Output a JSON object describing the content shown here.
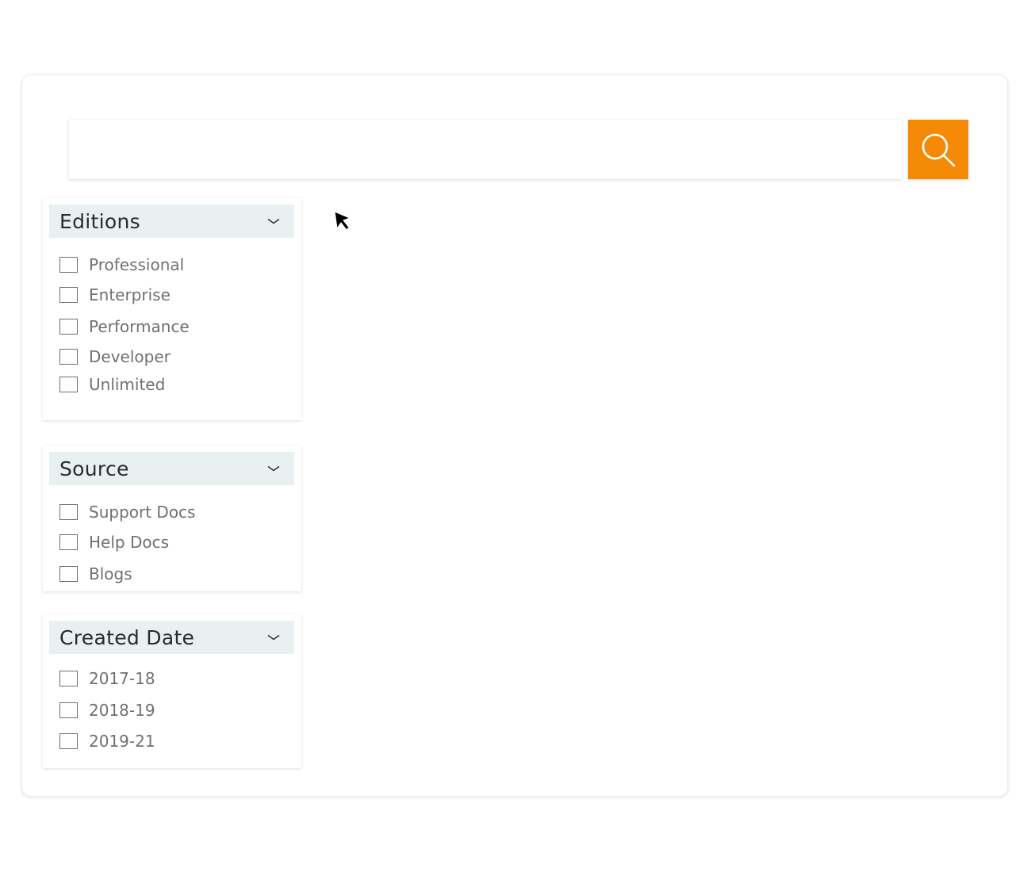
{
  "search": {
    "value": "",
    "placeholder": ""
  },
  "colors": {
    "accent": "#f58a07",
    "panel_header_bg": "#e8f0f2",
    "option_text": "#707070"
  },
  "filters": {
    "editions": {
      "title": "Editions",
      "options": [
        "Professional",
        "Enterprise",
        "Performance",
        "Developer",
        "Unlimited"
      ]
    },
    "source": {
      "title": "Source",
      "options": [
        "Support Docs",
        "Help Docs",
        "Blogs"
      ]
    },
    "created_date": {
      "title": "Created Date",
      "options": [
        "2017-18",
        "2018-19",
        "2019-21"
      ]
    }
  },
  "icons": {
    "search_button": "search-icon",
    "panel_toggle": "chevron-down-icon",
    "pointer": "mouse-cursor-icon"
  }
}
